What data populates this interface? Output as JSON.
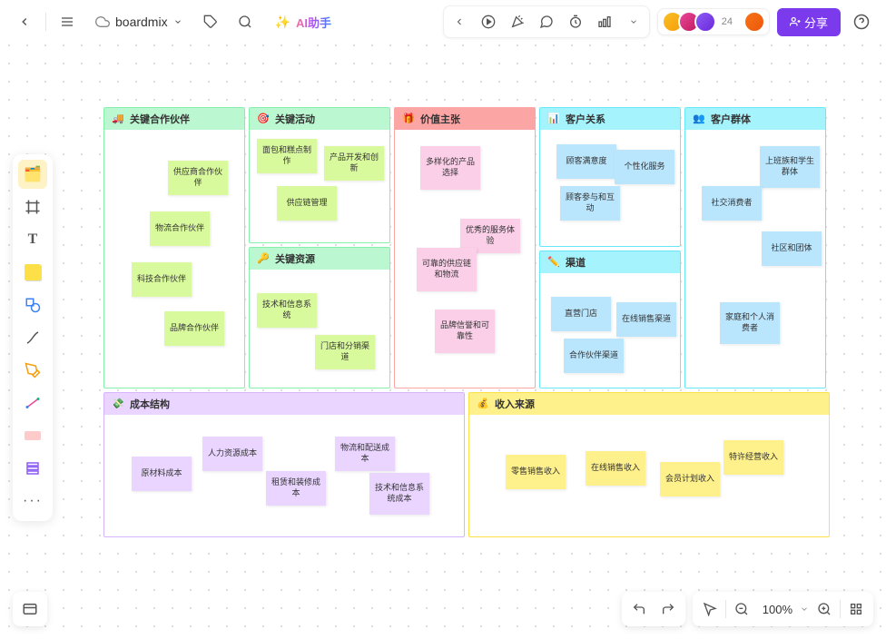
{
  "app": {
    "board_name": "boardmix",
    "ai_button": "AI助手",
    "avatar_count": "24",
    "share": "分享",
    "zoom": "100%"
  },
  "canvas": {
    "partners": {
      "title": "关键合作伙伴",
      "notes": [
        "供应商合作伙伴",
        "物流合作伙伴",
        "科技合作伙伴",
        "品牌合作伙伴"
      ]
    },
    "activities": {
      "title": "关键活动",
      "notes": [
        "面包和糕点制作",
        "产品开发和创新",
        "供应链管理"
      ]
    },
    "resources": {
      "title": "关键资源",
      "notes": [
        "技术和信息系统",
        "门店和分销渠道"
      ]
    },
    "value": {
      "title": "价值主张",
      "notes": [
        "多样化的产品选择",
        "优秀的服务体验",
        "可靠的供应链和物流",
        "品牌信誉和可靠性"
      ]
    },
    "relationships": {
      "title": "客户关系",
      "notes": [
        "顾客满意度",
        "个性化服务",
        "顾客参与和互动"
      ]
    },
    "channels": {
      "title": "渠道",
      "notes": [
        "直营门店",
        "在线销售渠道",
        "合作伙伴渠道"
      ]
    },
    "segments": {
      "title": "客户群体",
      "notes": [
        "上班族和学生群体",
        "社交消费者",
        "社区和团体",
        "家庭和个人消费者"
      ]
    },
    "costs": {
      "title": "成本结构",
      "notes": [
        "原材料成本",
        "人力资源成本",
        "租赁和装修成本",
        "物流和配送成本",
        "技术和信息系统成本"
      ]
    },
    "revenue": {
      "title": "收入来源",
      "notes": [
        "零售销售收入",
        "在线销售收入",
        "会员计划收入",
        "特许经营收入"
      ]
    }
  }
}
